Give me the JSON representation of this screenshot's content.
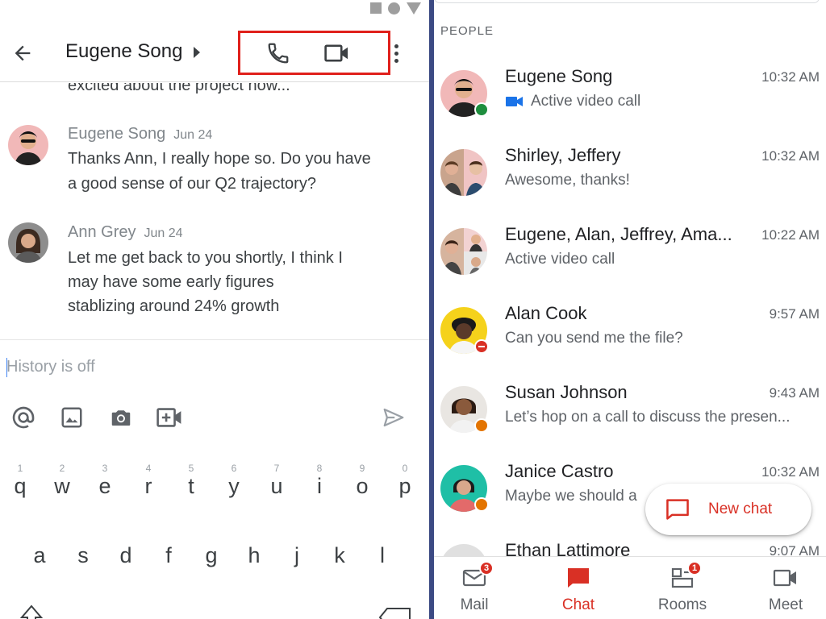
{
  "chat": {
    "title": "Eugene Song",
    "previous_line": "excited about the project now...",
    "messages": [
      {
        "sender": "Eugene Song",
        "date": "Jun 24",
        "lines": [
          "Thanks Ann, I really hope so. Do you have",
          "a good sense of our Q2 trajectory?"
        ]
      },
      {
        "sender": "Ann Grey",
        "date": "Jun 24",
        "lines": [
          "Let me get back to you shortly, I think I",
          "may have some early figures",
          "stablizing around 24% growth"
        ]
      }
    ],
    "composer_placeholder": "History is off",
    "tool_icons": [
      "at-icon",
      "image-icon",
      "camera-icon",
      "add-video-icon",
      "send-icon"
    ]
  },
  "keyboard": {
    "row1": [
      {
        "num": "1",
        "letter": "q"
      },
      {
        "num": "2",
        "letter": "w"
      },
      {
        "num": "3",
        "letter": "e"
      },
      {
        "num": "4",
        "letter": "r"
      },
      {
        "num": "5",
        "letter": "t"
      },
      {
        "num": "6",
        "letter": "y"
      },
      {
        "num": "7",
        "letter": "u"
      },
      {
        "num": "8",
        "letter": "i"
      },
      {
        "num": "9",
        "letter": "o"
      },
      {
        "num": "0",
        "letter": "p"
      }
    ],
    "row2": [
      "a",
      "s",
      "d",
      "f",
      "g",
      "h",
      "j",
      "k",
      "l"
    ]
  },
  "list": {
    "section_label": "PEOPLE",
    "rows": [
      {
        "name": "Eugene Song",
        "time": "10:32 AM",
        "preview": "Active video call",
        "preview_icon": "video-icon",
        "status": "online"
      },
      {
        "name": "Shirley, Jeffery",
        "time": "10:32 AM",
        "preview": "Awesome, thanks!",
        "status": "none"
      },
      {
        "name": "Eugene, Alan, Jeffrey, Ama...",
        "time": "10:22 AM",
        "preview": "Active video call",
        "status": "none"
      },
      {
        "name": "Alan Cook",
        "time": "9:57 AM",
        "preview": "Can you send me the file?",
        "status": "dnd"
      },
      {
        "name": "Susan Johnson",
        "time": "9:43 AM",
        "preview": "Let’s hop on a call to discuss the presen...",
        "status": "away"
      },
      {
        "name": "Janice Castro",
        "time": "10:32 AM",
        "preview": "Maybe we should a",
        "status": "away"
      },
      {
        "name": "Ethan Lattimore",
        "time": "9:07 AM",
        "preview": "",
        "status": "none"
      }
    ]
  },
  "new_chat": {
    "label": "New chat"
  },
  "nav": {
    "items": [
      {
        "label": "Mail",
        "badge": "3",
        "icon": "mail-icon"
      },
      {
        "label": "Chat",
        "badge": "",
        "icon": "chat-icon"
      },
      {
        "label": "Rooms",
        "badge": "1",
        "icon": "rooms-icon"
      },
      {
        "label": "Meet",
        "badge": "",
        "icon": "meet-icon"
      }
    ]
  },
  "colors": {
    "accent": "#d93025",
    "highlight": "#e0201b",
    "video_blue": "#1a73e8",
    "divider": "#3c4a83",
    "online": "#1e8e3e",
    "away": "#e37400"
  }
}
